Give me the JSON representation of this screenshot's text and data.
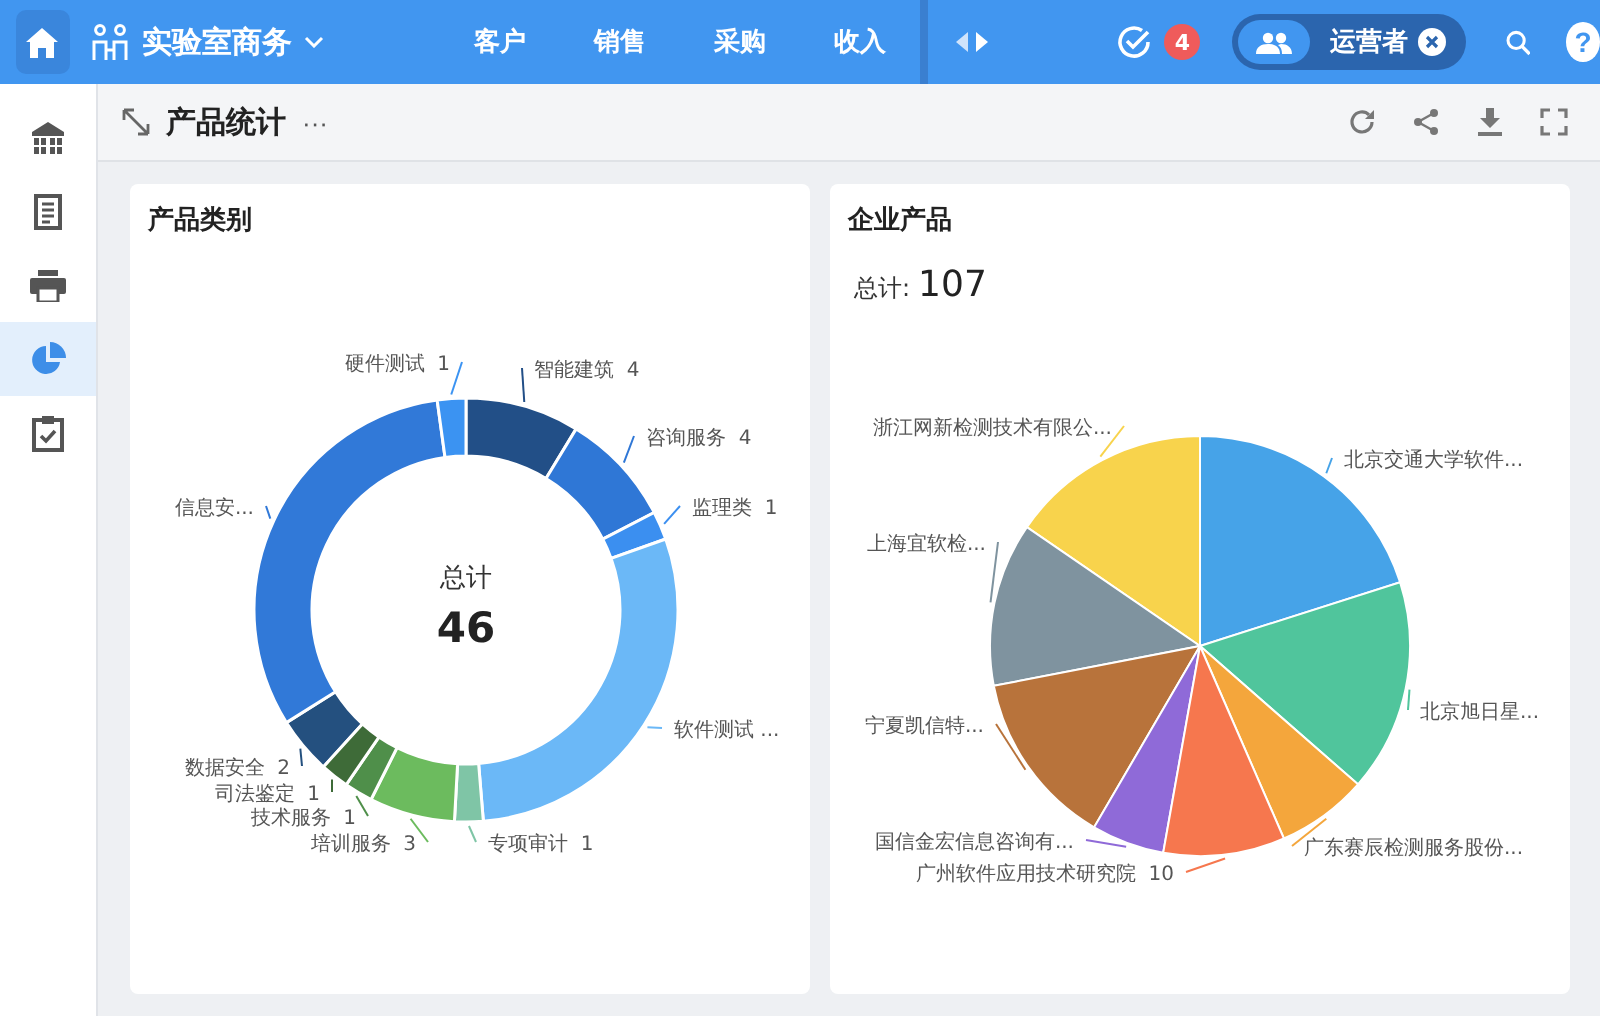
{
  "topbar": {
    "app_name": "实验室商务",
    "nav": [
      {
        "label": "客户"
      },
      {
        "label": "销售"
      },
      {
        "label": "采购"
      },
      {
        "label": "收入"
      }
    ],
    "badge": "4",
    "user": "运营者",
    "help": "?"
  },
  "sidebar": {
    "items": [
      {
        "kind": "home",
        "selected": false
      },
      {
        "kind": "document",
        "selected": false
      },
      {
        "kind": "printer",
        "selected": false
      },
      {
        "kind": "pie",
        "selected": true
      },
      {
        "kind": "checklist",
        "selected": false
      }
    ]
  },
  "header": {
    "title": "产品统计",
    "more": "···"
  },
  "cards": [
    {
      "title": "产品类别",
      "center_label": "总计",
      "center_value": "46",
      "slices": [
        {
          "label": "智能建筑  4",
          "color": "#224f87"
        },
        {
          "label": "咨询服务  4",
          "color": "#2f77d6"
        },
        {
          "label": "监理类  1",
          "color": "#3b8ff0"
        },
        {
          "label": "软件测试 ...",
          "color": "#6bb8f7"
        },
        {
          "label": "专项审计  1",
          "color": "#7fc5a6"
        },
        {
          "label": "培训服务  3",
          "color": "#6cbb5e"
        },
        {
          "label": "技术服务  1",
          "color": "#4f8f4a"
        },
        {
          "label": "数据安全  2",
          "color": "#24507f"
        },
        {
          "label": "司法鉴定  1",
          "color": "#3e6b38"
        },
        {
          "label": "信息安...",
          "color": "#3179d8"
        },
        {
          "label": "硬件测试  1",
          "color": "#3b93f2"
        }
      ]
    },
    {
      "title": "企业产品",
      "total_label": "总计:",
      "total_value": "107",
      "slices": [
        {
          "label": "浙江网新检测技术有限公...",
          "color": "#f8d34c"
        },
        {
          "label": "北京交通大学软件...",
          "color": "#46a3e8"
        },
        {
          "label": "上海宜软检...",
          "color": "#7f939f"
        },
        {
          "label": "宁夏凯信特...",
          "color": "#b8733b"
        },
        {
          "label": "北京旭日星...",
          "color": "#50c59c"
        },
        {
          "label": "国信金宏信息咨询有...",
          "color": "#8f6ad8"
        },
        {
          "label": "广东赛辰检测服务股份...",
          "color": "#f4a63c"
        },
        {
          "label": "广州软件应用技术研究院  10",
          "color": "#f6774e"
        }
      ]
    }
  ]
}
